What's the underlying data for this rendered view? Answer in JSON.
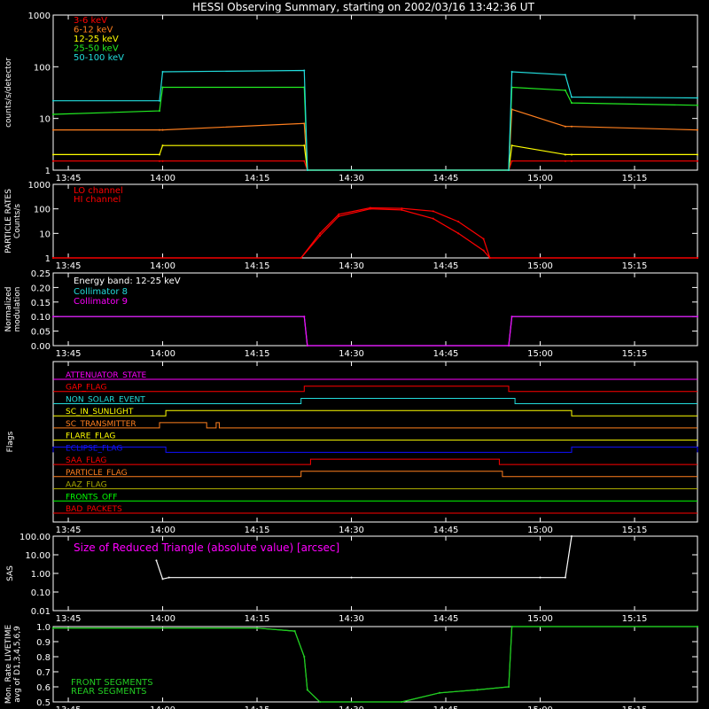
{
  "title": "HESSI Observing Summary, starting on 2002/03/16 13:42:36 UT",
  "colors": {
    "background": "#000000",
    "frame": "#ffffff",
    "red": "#ff0000",
    "orange": "#ff7f1e",
    "yellow": "#ffff00",
    "green": "#22ee22",
    "cyan": "#22dddd",
    "magenta": "#ff00ff",
    "blue": "#1111ff",
    "olive": "#aaaa00",
    "brightgreen": "#00ff00",
    "livegreen": "#22cc22"
  },
  "time_axis": {
    "range": [
      "13:42:36",
      "15:25:00"
    ],
    "tick_labels": [
      "13:45",
      "14:00",
      "14:15",
      "14:30",
      "14:45",
      "15:00",
      "15:15"
    ],
    "tick_times": [
      "13:45",
      "14:00",
      "14:15",
      "14:30",
      "14:45",
      "15:00",
      "15:15"
    ]
  },
  "chart_data": [
    {
      "id": "count-rates",
      "type": "line",
      "ylabel": "counts/s/detector",
      "y_scale": "log",
      "ylim": [
        1,
        1000
      ],
      "y_tick_labels": [
        "1",
        "10",
        "100",
        "1000"
      ],
      "y_tick_values": [
        1,
        10,
        100,
        1000
      ],
      "x": [
        "13:42:36",
        "13:59:30",
        "14:00:00",
        "14:22:30",
        "14:23:00",
        "14:55:00",
        "14:55:30",
        "15:04:00",
        "15:05:00",
        "15:25:00"
      ],
      "series": [
        {
          "name": "3-6 keV",
          "color": "red",
          "values": [
            1.5,
            1.5,
            1.5,
            1.5,
            0,
            0,
            1.5,
            1.5,
            1.5,
            1.5
          ]
        },
        {
          "name": "6-12 keV",
          "color": "orange",
          "values": [
            6,
            6,
            6,
            8,
            0,
            0,
            15,
            7,
            7,
            6
          ]
        },
        {
          "name": "12-25 keV",
          "color": "yellow",
          "values": [
            2,
            2,
            3,
            3,
            0,
            0,
            3,
            2,
            2,
            2
          ]
        },
        {
          "name": "25-50 keV",
          "color": "green",
          "values": [
            12,
            14,
            40,
            40,
            0,
            0,
            40,
            35,
            20,
            18
          ]
        },
        {
          "name": "50-100 keV",
          "color": "cyan",
          "values": [
            22,
            22,
            80,
            85,
            0,
            0,
            80,
            70,
            26,
            25
          ]
        }
      ]
    },
    {
      "id": "particle-rates",
      "type": "line",
      "ylabel": [
        "PARTICLE RATES",
        "Counts/s"
      ],
      "y_scale": "log",
      "ylim": [
        1,
        1000
      ],
      "y_tick_labels": [
        "1",
        "10",
        "100",
        "1000"
      ],
      "y_tick_values": [
        1,
        10,
        100,
        1000
      ],
      "x": [
        "13:42:36",
        "14:22:00",
        "14:25:00",
        "14:28:00",
        "14:33:00",
        "14:38:00",
        "14:43:00",
        "14:47:00",
        "14:51:00",
        "14:52:00",
        "15:25:00"
      ],
      "series": [
        {
          "name": "LO channel",
          "color": "red",
          "values": [
            1,
            1,
            10,
            60,
            110,
            105,
            80,
            30,
            6,
            1,
            1
          ]
        },
        {
          "name": "HI channel",
          "color": "red",
          "values": [
            1,
            1,
            8,
            50,
            100,
            90,
            40,
            10,
            2,
            1,
            1
          ]
        }
      ]
    },
    {
      "id": "modulation",
      "type": "line",
      "ylabel": [
        "Normalized",
        "modulation"
      ],
      "ylim": [
        0,
        0.25
      ],
      "y_tick_labels": [
        "0.00",
        "0.05",
        "0.10",
        "0.15",
        "0.20",
        "0.25"
      ],
      "y_tick_values": [
        0,
        0.05,
        0.1,
        0.15,
        0.2,
        0.25
      ],
      "annotation": "Energy band: 12-25 keV",
      "x": [
        "13:42:36",
        "14:22:30",
        "14:23:00",
        "14:55:00",
        "14:55:30",
        "15:25:00"
      ],
      "series": [
        {
          "name": "Collimator 8",
          "color": "cyan",
          "values": [
            0.1,
            0.1,
            0,
            0,
            0.1,
            0.1
          ]
        },
        {
          "name": "Collimator 9",
          "color": "magenta",
          "values": [
            0.1,
            0.1,
            0,
            0,
            0.1,
            0.1
          ]
        }
      ]
    },
    {
      "id": "flags",
      "type": "line",
      "ylabel": "Flags",
      "series": [
        {
          "name": "ATTENUATOR_STATE",
          "color": "magenta",
          "changes": []
        },
        {
          "name": "GAP_FLAG",
          "color": "red",
          "changes": [
            [
              "14:22:30",
              "14:55:00"
            ]
          ]
        },
        {
          "name": "NON_SOLAR_EVENT",
          "color": "cyan",
          "changes": [
            [
              "14:22:00",
              "14:56:00"
            ]
          ]
        },
        {
          "name": "SC_IN_SUNLIGHT",
          "color": "yellow",
          "changes": [
            [
              "14:00:30",
              "15:05:00"
            ]
          ]
        },
        {
          "name": "SC_TRANSMITTER",
          "color": "orange",
          "changes": [
            [
              "13:59:30",
              "14:07:00"
            ],
            [
              "14:08:30",
              "14:09:00"
            ]
          ]
        },
        {
          "name": "FLARE_FLAG",
          "color": "yellow",
          "changes": []
        },
        {
          "name": "ECLIPSE_FLAG",
          "color": "blue",
          "changes": [
            [
              "13:42:36",
              "14:00:30"
            ],
            [
              "15:05:00",
              "15:25:00"
            ]
          ]
        },
        {
          "name": "SAA_FLAG",
          "color": "red",
          "changes": [
            [
              "14:23:30",
              "14:53:30"
            ]
          ]
        },
        {
          "name": "PARTICLE_FLAG",
          "color": "orange",
          "changes": [
            [
              "14:22:00",
              "14:54:00"
            ]
          ]
        },
        {
          "name": "AAZ_FLAG",
          "color": "olive",
          "changes": []
        },
        {
          "name": "FRONTS_OFF",
          "color": "brightgreen",
          "changes": []
        },
        {
          "name": "BAD_PACKETS",
          "color": "red",
          "changes": []
        }
      ]
    },
    {
      "id": "sas",
      "type": "line",
      "ylabel": "SAS",
      "y_scale": "log",
      "ylim": [
        0.01,
        100
      ],
      "y_tick_labels": [
        "0.01",
        "0.10",
        "1.00",
        "10.00",
        "100.00"
      ],
      "y_tick_values": [
        0.01,
        0.1,
        1,
        10,
        100
      ],
      "annotation": "Size of Reduced Triangle (absolute value) [arcsec]",
      "x": [
        "13:59:00",
        "14:00:00",
        "14:01:00",
        "14:30:00",
        "15:00:00",
        "15:04:00",
        "15:05:00"
      ],
      "series": [
        {
          "name": "SAS",
          "color": "frame",
          "values": [
            5,
            0.5,
            0.6,
            0.6,
            0.6,
            0.6,
            100
          ]
        }
      ]
    },
    {
      "id": "livetime",
      "type": "line",
      "ylabel": [
        "Mon. Rate LIVETIME",
        "avg of D1,3,4,5,6,9"
      ],
      "ylim": [
        0.5,
        1.0
      ],
      "y_tick_labels": [
        "0.5",
        "0.6",
        "0.7",
        "0.8",
        "0.9",
        "1.0"
      ],
      "y_tick_values": [
        0.5,
        0.6,
        0.7,
        0.8,
        0.9,
        1.0
      ],
      "x": [
        "13:42:36",
        "14:15:00",
        "14:21:00",
        "14:22:30",
        "14:23:00",
        "14:25:00",
        "14:38:00",
        "14:44:00",
        "14:50:00",
        "14:55:00",
        "14:55:30",
        "15:25:00"
      ],
      "series": [
        {
          "name": "FRONT SEGMENTS",
          "color": "livegreen",
          "values": [
            0.99,
            0.99,
            0.97,
            0.8,
            0.58,
            0.5,
            0.5,
            0.56,
            0.58,
            0.6,
            1.0,
            1.0
          ]
        },
        {
          "name": "REAR SEGMENTS",
          "color": "livegreen",
          "values": [
            0.99,
            0.99,
            0.97,
            0.8,
            0.58,
            0.5,
            0.5,
            0.56,
            0.58,
            0.6,
            1.0,
            1.0
          ]
        }
      ]
    }
  ]
}
